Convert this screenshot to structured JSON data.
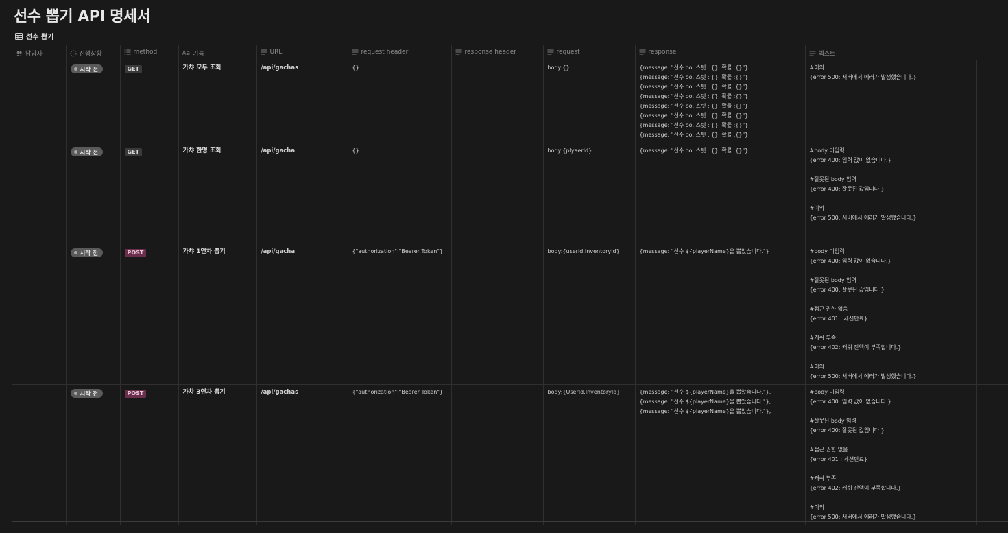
{
  "page": {
    "title": "선수 뽑기 API 명세서"
  },
  "view": {
    "label": "선수 뽑기",
    "icon": "table-icon"
  },
  "columns": [
    {
      "key": "assignee",
      "label": "담당자",
      "icon": "people-icon"
    },
    {
      "key": "status",
      "label": "진행상황",
      "icon": "status-icon"
    },
    {
      "key": "method",
      "label": "method",
      "icon": "list-icon"
    },
    {
      "key": "feature",
      "label": "기능",
      "icon": "title-icon",
      "icon_text": "Aa"
    },
    {
      "key": "url",
      "label": "URL",
      "icon": "text-icon"
    },
    {
      "key": "request_header",
      "label": "request header",
      "icon": "text-icon"
    },
    {
      "key": "response_header",
      "label": "response header",
      "icon": "text-icon"
    },
    {
      "key": "request",
      "label": "request",
      "icon": "text-icon"
    },
    {
      "key": "response",
      "label": "response",
      "icon": "text-icon"
    },
    {
      "key": "text",
      "label": "텍스트",
      "icon": "text-icon"
    }
  ],
  "rows": [
    {
      "assignee": "",
      "status": "시작 전",
      "method": "GET",
      "method_color": "#3a3a3a",
      "feature": "가챠 모두 조회",
      "url": "/api/gachas",
      "request_header": "{}",
      "response_header": "",
      "request": "body:{}",
      "response": "{message: \"선수 oo, 스텟 : {}, 확률 :{}\"},\n{message: \"선수 oo, 스텟 : {}, 확률 :{}\"},\n{message: \"선수 oo, 스텟 : {}, 확률 :{}\"},\n{message: \"선수 oo, 스텟 : {}, 확률 :{}\"},\n{message: \"선수 oo, 스텟 : {}, 확률 :{}\"},\n{message: \"선수 oo, 스텟 : {}, 확률 :{}\"},\n{message: \"선수 oo, 스텟 : {}, 확률 :{}\"},\n{message: \"선수 oo, 스텟 : {}, 확률 :{}\"}",
      "text": "#이외\n{error 500: 서버에서 에러가 발생했습니다.}"
    },
    {
      "assignee": "",
      "status": "시작 전",
      "method": "GET",
      "method_color": "#3a3a3a",
      "feature": "가챠 한명 조회",
      "url": "/api/gacha",
      "request_header": "{}",
      "response_header": "",
      "request": "body:{plyaerId}",
      "response": "{message: \"선수 oo, 스텟 : {}, 확률 :{}\"}",
      "text": "#body 미입력\n{error 400: 입력 값이 없습니다.}\n\n#잘못된 body 입력\n{error 400: 잘못된 값입니다.}\n\n#이외\n{error 500: 서버에서 에러가 발생했습니다.}"
    },
    {
      "assignee": "",
      "status": "시작 전",
      "method": "POST",
      "method_color": "#6b2f4e",
      "feature": "가챠 1연차 뽑기",
      "url": "/api/gacha",
      "request_header": "{\"authorization\":\"Bearer Token\"}",
      "response_header": "",
      "request": "body:{userId,InventoryId}",
      "response": "{message: \"선수 ${playerName}을 뽑았습니다.\"}",
      "text": "#body 미입력\n{error 400: 입력 값이 없습니다.}\n\n#잘못된 body 입력\n{error 400: 잘못된 값입니다.}\n\n#접근 권한 없음\n{error 401 : 세션만료}\n\n#캐쉬 부족\n{error 402: 캐쉬 잔액이 부족합니다.}\n\n#이외\n{error 500: 서버에서 에러가 발생했습니다.}"
    },
    {
      "assignee": "",
      "status": "시작 전",
      "method": "POST",
      "method_color": "#6b2f4e",
      "feature": "가챠 3연차 뽑기",
      "url": "/api/gachas",
      "request_header": "{\"authorization\":\"Bearer Token\"}",
      "response_header": "",
      "request": "body:{UserId,InventoryId}",
      "response": "{message: \"선수 ${playerName}을 뽑았습니다.\"},\n{message: \"선수 ${playerName}을 뽑았습니다.\"},\n{message: \"선수 ${playerName}을 뽑았습니다.\"},",
      "text": "#body 미입력\n{error 400: 입력 값이 없습니다.}\n\n#잘못된 body 입력\n{error 400: 잘못된 값입니다.}\n\n#접근 권한 없음\n{error 401 : 세션만료}\n\n#캐쉬 부족\n{error 402: 캐쉬 잔액이 부족합니다.}\n\n#이외\n{error 500: 서버에서 에러가 발생했습니다.}"
    }
  ]
}
